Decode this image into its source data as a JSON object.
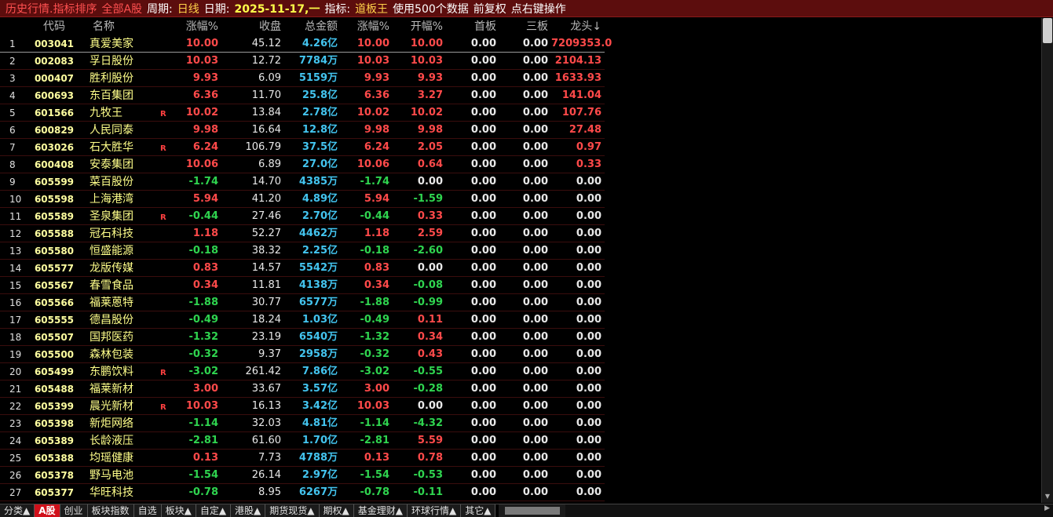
{
  "title": {
    "view": "历史行情.指标排序",
    "market": "全部A股",
    "period_label": "周期:",
    "period_value": "日线",
    "date_label": "日期:",
    "date_value": "2025-11-17,一",
    "indicator_label": "指标:",
    "indicator_value": "道板王",
    "data_count": "使用500个数据",
    "adjust": "前复权",
    "hint": "点右键操作"
  },
  "columns": [
    "",
    "代码",
    "名称",
    "涨幅%",
    "收盘",
    "总金额",
    "涨幅%",
    "开幅%",
    "首板",
    "三板",
    "龙头↓"
  ],
  "colors": {
    "up": "#ff4a4a",
    "down": "#2fd44f",
    "flat": "#e8e8e8",
    "amount": "#43c4ef",
    "code": "#ffffa0",
    "name": "#ffff8a",
    "active_tab": "#d0101a"
  },
  "rows": [
    {
      "idx": "1",
      "code": "003041",
      "name": "真爱美家",
      "r": "",
      "chg": "10.00",
      "close": "45.12",
      "amt": "4.26亿",
      "chg2": "10.00",
      "open": "10.00",
      "b1": "0.00",
      "b3": "0.00",
      "dt": "7209353.0"
    },
    {
      "idx": "2",
      "code": "002083",
      "name": "孚日股份",
      "r": "",
      "chg": "10.03",
      "close": "12.72",
      "amt": "7784万",
      "chg2": "10.03",
      "open": "10.03",
      "b1": "0.00",
      "b3": "0.00",
      "dt": "2104.13"
    },
    {
      "idx": "3",
      "code": "000407",
      "name": "胜利股份",
      "r": "",
      "chg": "9.93",
      "close": "6.09",
      "amt": "5159万",
      "chg2": "9.93",
      "open": "9.93",
      "b1": "0.00",
      "b3": "0.00",
      "dt": "1633.93"
    },
    {
      "idx": "4",
      "code": "600693",
      "name": "东百集团",
      "r": "",
      "chg": "6.36",
      "close": "11.70",
      "amt": "25.8亿",
      "chg2": "6.36",
      "open": "3.27",
      "b1": "0.00",
      "b3": "0.00",
      "dt": "141.04"
    },
    {
      "idx": "5",
      "code": "601566",
      "name": "九牧王",
      "r": "R",
      "chg": "10.02",
      "close": "13.84",
      "amt": "2.78亿",
      "chg2": "10.02",
      "open": "10.02",
      "b1": "0.00",
      "b3": "0.00",
      "dt": "107.76"
    },
    {
      "idx": "6",
      "code": "600829",
      "name": "人民同泰",
      "r": "",
      "chg": "9.98",
      "close": "16.64",
      "amt": "12.8亿",
      "chg2": "9.98",
      "open": "9.98",
      "b1": "0.00",
      "b3": "0.00",
      "dt": "27.48"
    },
    {
      "idx": "7",
      "code": "603026",
      "name": "石大胜华",
      "r": "R",
      "chg": "6.24",
      "close": "106.79",
      "amt": "37.5亿",
      "chg2": "6.24",
      "open": "2.05",
      "b1": "0.00",
      "b3": "0.00",
      "dt": "0.97"
    },
    {
      "idx": "8",
      "code": "600408",
      "name": "安泰集团",
      "r": "",
      "chg": "10.06",
      "close": "6.89",
      "amt": "27.0亿",
      "chg2": "10.06",
      "open": "0.64",
      "b1": "0.00",
      "b3": "0.00",
      "dt": "0.33"
    },
    {
      "idx": "9",
      "code": "605599",
      "name": "菜百股份",
      "r": "",
      "chg": "-1.74",
      "close": "14.70",
      "amt": "4385万",
      "chg2": "-1.74",
      "open": "0.00",
      "b1": "0.00",
      "b3": "0.00",
      "dt": "0.00"
    },
    {
      "idx": "10",
      "code": "605598",
      "name": "上海港湾",
      "r": "",
      "chg": "5.94",
      "close": "41.20",
      "amt": "4.89亿",
      "chg2": "5.94",
      "open": "-1.59",
      "b1": "0.00",
      "b3": "0.00",
      "dt": "0.00"
    },
    {
      "idx": "11",
      "code": "605589",
      "name": "圣泉集团",
      "r": "R",
      "chg": "-0.44",
      "close": "27.46",
      "amt": "2.70亿",
      "chg2": "-0.44",
      "open": "0.33",
      "b1": "0.00",
      "b3": "0.00",
      "dt": "0.00"
    },
    {
      "idx": "12",
      "code": "605588",
      "name": "冠石科技",
      "r": "",
      "chg": "1.18",
      "close": "52.27",
      "amt": "4462万",
      "chg2": "1.18",
      "open": "2.59",
      "b1": "0.00",
      "b3": "0.00",
      "dt": "0.00"
    },
    {
      "idx": "13",
      "code": "605580",
      "name": "恒盛能源",
      "r": "",
      "chg": "-0.18",
      "close": "38.32",
      "amt": "2.25亿",
      "chg2": "-0.18",
      "open": "-2.60",
      "b1": "0.00",
      "b3": "0.00",
      "dt": "0.00"
    },
    {
      "idx": "14",
      "code": "605577",
      "name": "龙版传媒",
      "r": "",
      "chg": "0.83",
      "close": "14.57",
      "amt": "5542万",
      "chg2": "0.83",
      "open": "0.00",
      "b1": "0.00",
      "b3": "0.00",
      "dt": "0.00"
    },
    {
      "idx": "15",
      "code": "605567",
      "name": "春雪食品",
      "r": "",
      "chg": "0.34",
      "close": "11.81",
      "amt": "4138万",
      "chg2": "0.34",
      "open": "-0.08",
      "b1": "0.00",
      "b3": "0.00",
      "dt": "0.00"
    },
    {
      "idx": "16",
      "code": "605566",
      "name": "福莱蒽特",
      "r": "",
      "chg": "-1.88",
      "close": "30.77",
      "amt": "6577万",
      "chg2": "-1.88",
      "open": "-0.99",
      "b1": "0.00",
      "b3": "0.00",
      "dt": "0.00"
    },
    {
      "idx": "17",
      "code": "605555",
      "name": "德昌股份",
      "r": "",
      "chg": "-0.49",
      "close": "18.24",
      "amt": "1.03亿",
      "chg2": "-0.49",
      "open": "0.11",
      "b1": "0.00",
      "b3": "0.00",
      "dt": "0.00"
    },
    {
      "idx": "18",
      "code": "605507",
      "name": "国邦医药",
      "r": "",
      "chg": "-1.32",
      "close": "23.19",
      "amt": "6540万",
      "chg2": "-1.32",
      "open": "0.34",
      "b1": "0.00",
      "b3": "0.00",
      "dt": "0.00"
    },
    {
      "idx": "19",
      "code": "605500",
      "name": "森林包装",
      "r": "",
      "chg": "-0.32",
      "close": "9.37",
      "amt": "2958万",
      "chg2": "-0.32",
      "open": "0.43",
      "b1": "0.00",
      "b3": "0.00",
      "dt": "0.00"
    },
    {
      "idx": "20",
      "code": "605499",
      "name": "东鹏饮料",
      "r": "R",
      "chg": "-3.02",
      "close": "261.42",
      "amt": "7.86亿",
      "chg2": "-3.02",
      "open": "-0.55",
      "b1": "0.00",
      "b3": "0.00",
      "dt": "0.00"
    },
    {
      "idx": "21",
      "code": "605488",
      "name": "福莱新材",
      "r": "",
      "chg": "3.00",
      "close": "33.67",
      "amt": "3.57亿",
      "chg2": "3.00",
      "open": "-0.28",
      "b1": "0.00",
      "b3": "0.00",
      "dt": "0.00"
    },
    {
      "idx": "22",
      "code": "605399",
      "name": "晨光新材",
      "r": "R",
      "chg": "10.03",
      "close": "16.13",
      "amt": "3.42亿",
      "chg2": "10.03",
      "open": "0.00",
      "b1": "0.00",
      "b3": "0.00",
      "dt": "0.00"
    },
    {
      "idx": "23",
      "code": "605398",
      "name": "新炬网络",
      "r": "",
      "chg": "-1.14",
      "close": "32.03",
      "amt": "4.81亿",
      "chg2": "-1.14",
      "open": "-4.32",
      "b1": "0.00",
      "b3": "0.00",
      "dt": "0.00"
    },
    {
      "idx": "24",
      "code": "605389",
      "name": "长龄液压",
      "r": "",
      "chg": "-2.81",
      "close": "61.60",
      "amt": "1.70亿",
      "chg2": "-2.81",
      "open": "5.59",
      "b1": "0.00",
      "b3": "0.00",
      "dt": "0.00"
    },
    {
      "idx": "25",
      "code": "605388",
      "name": "均瑶健康",
      "r": "",
      "chg": "0.13",
      "close": "7.73",
      "amt": "4788万",
      "chg2": "0.13",
      "open": "0.78",
      "b1": "0.00",
      "b3": "0.00",
      "dt": "0.00"
    },
    {
      "idx": "26",
      "code": "605378",
      "name": "野马电池",
      "r": "",
      "chg": "-1.54",
      "close": "26.14",
      "amt": "2.97亿",
      "chg2": "-1.54",
      "open": "-0.53",
      "b1": "0.00",
      "b3": "0.00",
      "dt": "0.00"
    },
    {
      "idx": "27",
      "code": "605377",
      "name": "华旺科技",
      "r": "",
      "chg": "-0.78",
      "close": "8.95",
      "amt": "6267万",
      "chg2": "-0.78",
      "open": "-0.11",
      "b1": "0.00",
      "b3": "0.00",
      "dt": "0.00"
    }
  ],
  "tabs": [
    "分类▲",
    "A股",
    "创业",
    "板块指数",
    "自选",
    "板块▲",
    "自定▲",
    "港股▲",
    "期货现货▲",
    "期权▲",
    "基金理财▲",
    "环球行情▲",
    "其它▲"
  ],
  "active_tab": 1
}
